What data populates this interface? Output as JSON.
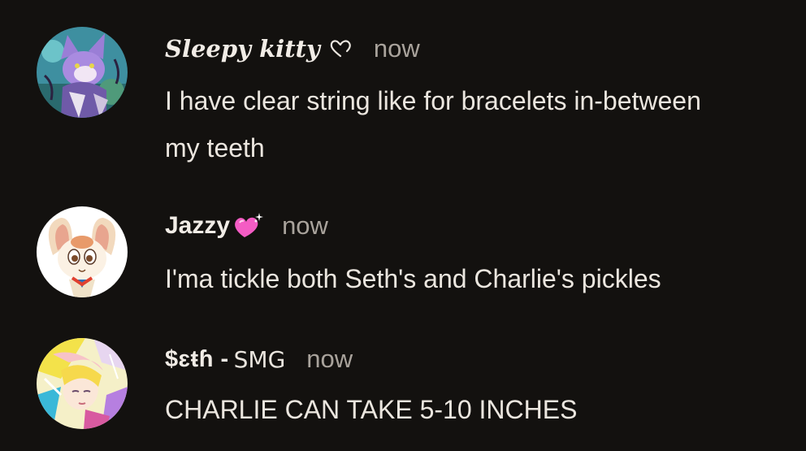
{
  "comments": [
    {
      "username": "Sleepy kitty",
      "username_decoration": "heart-outline-icon",
      "time": "now",
      "text": "I have clear string like for bracelets in-between my teeth",
      "avatar": "lavender-cat-character-avatar"
    },
    {
      "username": "Jazzy",
      "username_decoration": "sparkling-pink-heart-icon",
      "time": "now",
      "text": "I'ma tickle both Seth's and Charlie's pickles",
      "avatar": "cream-rabbit-character-avatar"
    },
    {
      "username": "$ɛŧɦ -",
      "username_tag": "SMG",
      "time": "now",
      "text": "CHARLIE CAN TAKE 5-10 INCHES",
      "avatar": "colorful-anime-character-avatar"
    }
  ],
  "colors": {
    "background": "#13110f",
    "text": "#ebe6df",
    "muted": "#a9a39c",
    "heart_pink": "#f45cc4"
  }
}
